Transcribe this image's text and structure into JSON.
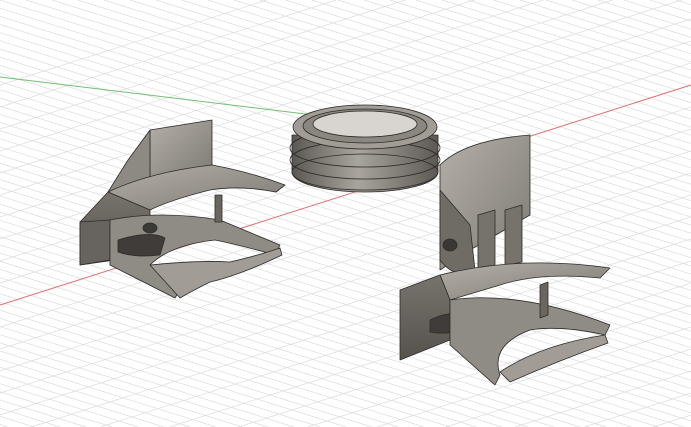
{
  "viewport": {
    "background": "#ffffff",
    "grid_color": "#dcdcdc",
    "x_axis_color": "#e07070",
    "y_axis_color": "#70c070",
    "model_light": "#a7a39c",
    "model_mid": "#7b7770",
    "model_dark": "#4e4b47",
    "edge_color": "#2e2c2a"
  }
}
